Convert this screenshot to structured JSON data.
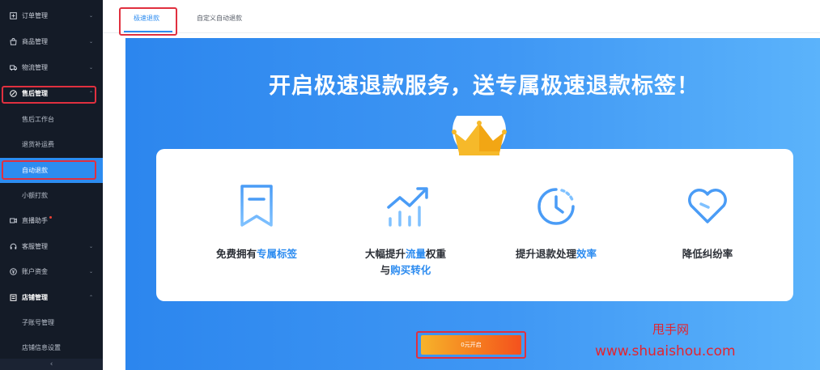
{
  "sidebar": {
    "items": [
      {
        "label": "订单管理",
        "icon": "order-icon",
        "chevron": "⌄"
      },
      {
        "label": "商品管理",
        "icon": "bag-icon",
        "chevron": "⌄"
      },
      {
        "label": "物流管理",
        "icon": "truck-icon",
        "chevron": "⌄"
      },
      {
        "label": "售后管理",
        "icon": "aftersale-icon",
        "chevron": "⌃"
      },
      {
        "label": "售后工作台"
      },
      {
        "label": "退货补运费"
      },
      {
        "label": "自动退款"
      },
      {
        "label": "小额打款"
      },
      {
        "label": "直播助手",
        "icon": "live-icon"
      },
      {
        "label": "客服管理",
        "icon": "headset-icon",
        "chevron": "⌄"
      },
      {
        "label": "账户资金",
        "icon": "money-icon",
        "chevron": "⌄"
      },
      {
        "label": "店铺管理",
        "icon": "shop-icon",
        "chevron": "⌃"
      },
      {
        "label": "子账号管理"
      },
      {
        "label": "店铺信息设置"
      }
    ],
    "collapse_glyph": "‹"
  },
  "tabs": [
    {
      "label": "极速退款"
    },
    {
      "label": "自定义自动退款"
    }
  ],
  "banner": {
    "headline": "开启极速退款服务，送专属极速退款标签！",
    "features": [
      {
        "icon": "bookmark-icon",
        "parts": [
          {
            "t": "免费拥有"
          },
          {
            "t": "专属标签",
            "hl": true
          }
        ]
      },
      {
        "icon": "growth-chart-icon",
        "parts": [
          {
            "t": "大幅提升"
          },
          {
            "t": "流量",
            "hl": true
          },
          {
            "t": "权重"
          },
          {
            "br": true
          },
          {
            "t": "与"
          },
          {
            "t": "购买转化",
            "hl": true
          }
        ]
      },
      {
        "icon": "clock-icon",
        "parts": [
          {
            "t": "提升退款处理"
          },
          {
            "t": "效率",
            "hl": true
          }
        ]
      },
      {
        "icon": "heart-icon",
        "parts": [
          {
            "t": "降低纠纷率"
          }
        ]
      }
    ],
    "cta": "0元开启"
  },
  "watermark": {
    "line1": "甩手网",
    "line2": "www.shuaishou.com"
  },
  "colors": {
    "sidebar_bg": "#141b27",
    "accent": "#2d8cf0",
    "highlight_border": "#e0303f",
    "cta_gradient_start": "#f7b32b",
    "cta_gradient_end": "#f4511e",
    "watermark": "#e4232e"
  }
}
